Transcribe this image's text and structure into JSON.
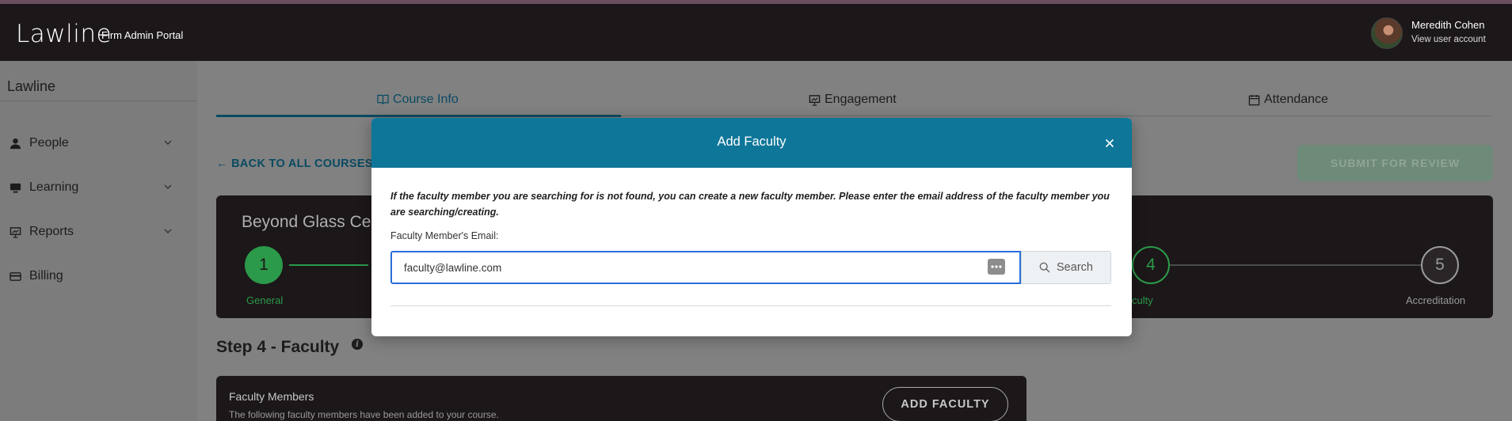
{
  "header": {
    "logo": "Lawline",
    "portal_label": "Firm Admin Portal",
    "user_name": "Meredith Cohen",
    "user_link": "View user account"
  },
  "sidebar": {
    "title": "Lawline",
    "items": [
      {
        "label": "People",
        "icon": "person-icon"
      },
      {
        "label": "Learning",
        "icon": "monitor-icon"
      },
      {
        "label": "Reports",
        "icon": "presentation-icon"
      },
      {
        "label": "Billing",
        "icon": "credit-card-icon"
      }
    ]
  },
  "tabs": [
    {
      "label": "Course Info",
      "icon": "book-icon",
      "active": true
    },
    {
      "label": "Engagement",
      "icon": "presentation-icon",
      "active": false
    },
    {
      "label": "Attendance",
      "icon": "calendar-icon",
      "active": false
    }
  ],
  "back_link": "BACK TO ALL COURSES",
  "submit_button": "SUBMIT FOR REVIEW",
  "course": {
    "title": "Beyond Glass Ce",
    "steps": [
      {
        "number": "1",
        "label": "General",
        "state": "completed"
      },
      {
        "number": "4",
        "label": "culty",
        "state": "current"
      },
      {
        "number": "5",
        "label": "Accreditation",
        "state": "upcoming"
      }
    ]
  },
  "step_section": {
    "heading": "Step 4 - Faculty",
    "card_title": "Faculty Members",
    "card_desc": "The following faculty members have been added to your course.",
    "add_button": "ADD FACULTY"
  },
  "modal": {
    "title": "Add Faculty",
    "note": "If the faculty member you are searching for is not found, you can create a new faculty member. Please enter the email address of the faculty member you are searching/creating.",
    "email_label": "Faculty Member's Email:",
    "email_value": "faculty@lawline.com",
    "search_label": "Search"
  },
  "colors": {
    "header_bg": "#1c1719",
    "modal_header": "#0e7698",
    "accent": "#0a4a63",
    "step_completed": "#2b9a4a",
    "input_focus": "#2a6ed8"
  }
}
